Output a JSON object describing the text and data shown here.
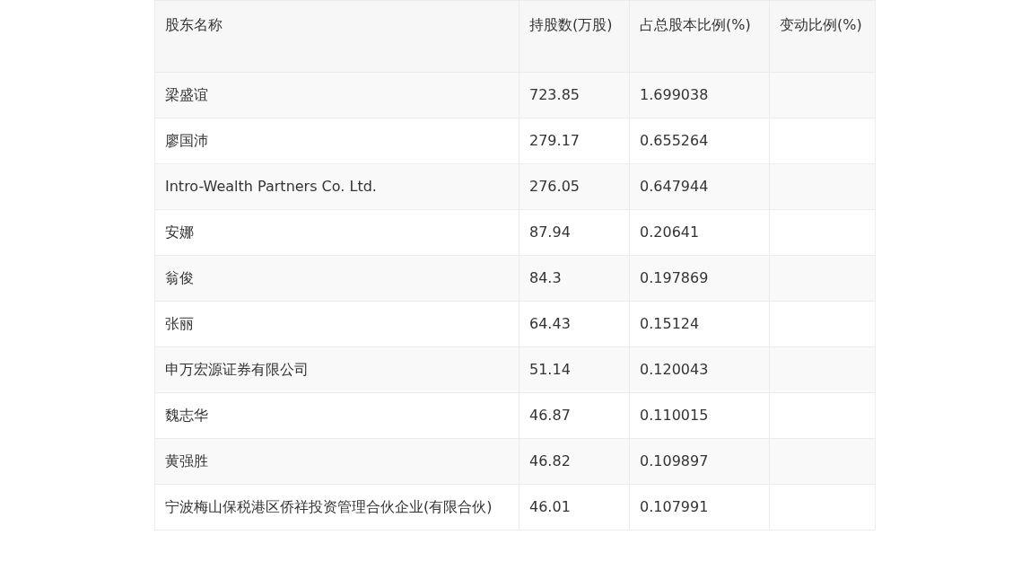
{
  "table": {
    "columns": [
      "股东名称",
      "持股数(万股)",
      "占总股本比例(%)",
      "变动比例(%)"
    ],
    "rows": [
      [
        "梁盛谊",
        "723.85",
        "1.699038"
      ],
      [
        "廖国沛",
        "279.17",
        "0.655264"
      ],
      [
        "Intro-Wealth Partners Co. Ltd.",
        "276.05",
        "0.647944"
      ],
      [
        "安娜",
        "87.94",
        "0.20641"
      ],
      [
        "翁俊",
        "84.3",
        "0.197869"
      ],
      [
        "张丽",
        "64.43",
        "0.15124"
      ],
      [
        "申万宏源证券有限公司",
        "51.14",
        "0.120043"
      ],
      [
        "魏志华",
        "46.87",
        "0.110015"
      ],
      [
        "黄强胜",
        "46.82",
        "0.109897"
      ],
      [
        "宁波梅山保税港区侨祥投资管理合伙企业(有限合伙)",
        "46.01",
        "0.107991"
      ]
    ]
  }
}
